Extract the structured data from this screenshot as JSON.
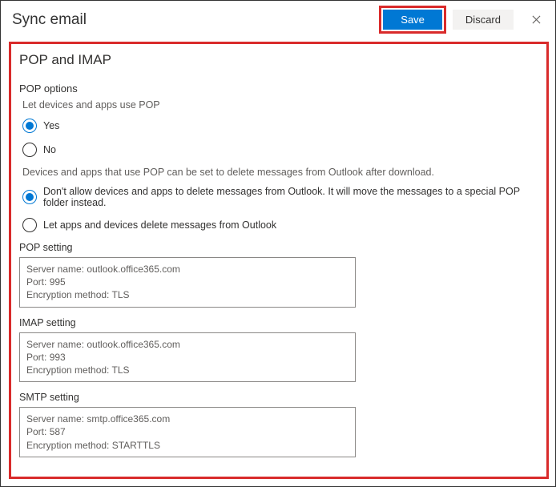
{
  "header": {
    "title": "Sync email",
    "save_label": "Save",
    "discard_label": "Discard"
  },
  "section": {
    "heading": "POP and IMAP",
    "pop_options_label": "POP options",
    "pop_options_desc": "Let devices and apps use POP",
    "pop_yes": "Yes",
    "pop_no": "No",
    "pop_delete_note": "Devices and apps that use POP can be set to delete messages from Outlook after download.",
    "pop_delete_dont": "Don't allow devices and apps to delete messages from Outlook. It will move the messages to a special POP folder instead.",
    "pop_delete_let": "Let apps and devices delete messages from Outlook"
  },
  "pop_setting": {
    "label": "POP setting",
    "server_label": "Server name:",
    "server": "outlook.office365.com",
    "port_label": "Port:",
    "port": "995",
    "enc_label": "Encryption method:",
    "enc": "TLS"
  },
  "imap_setting": {
    "label": "IMAP setting",
    "server_label": "Server name:",
    "server": "outlook.office365.com",
    "port_label": "Port:",
    "port": "993",
    "enc_label": "Encryption method:",
    "enc": "TLS"
  },
  "smtp_setting": {
    "label": "SMTP setting",
    "server_label": "Server name:",
    "server": "smtp.office365.com",
    "port_label": "Port:",
    "port": "587",
    "enc_label": "Encryption method:",
    "enc": "STARTTLS"
  }
}
